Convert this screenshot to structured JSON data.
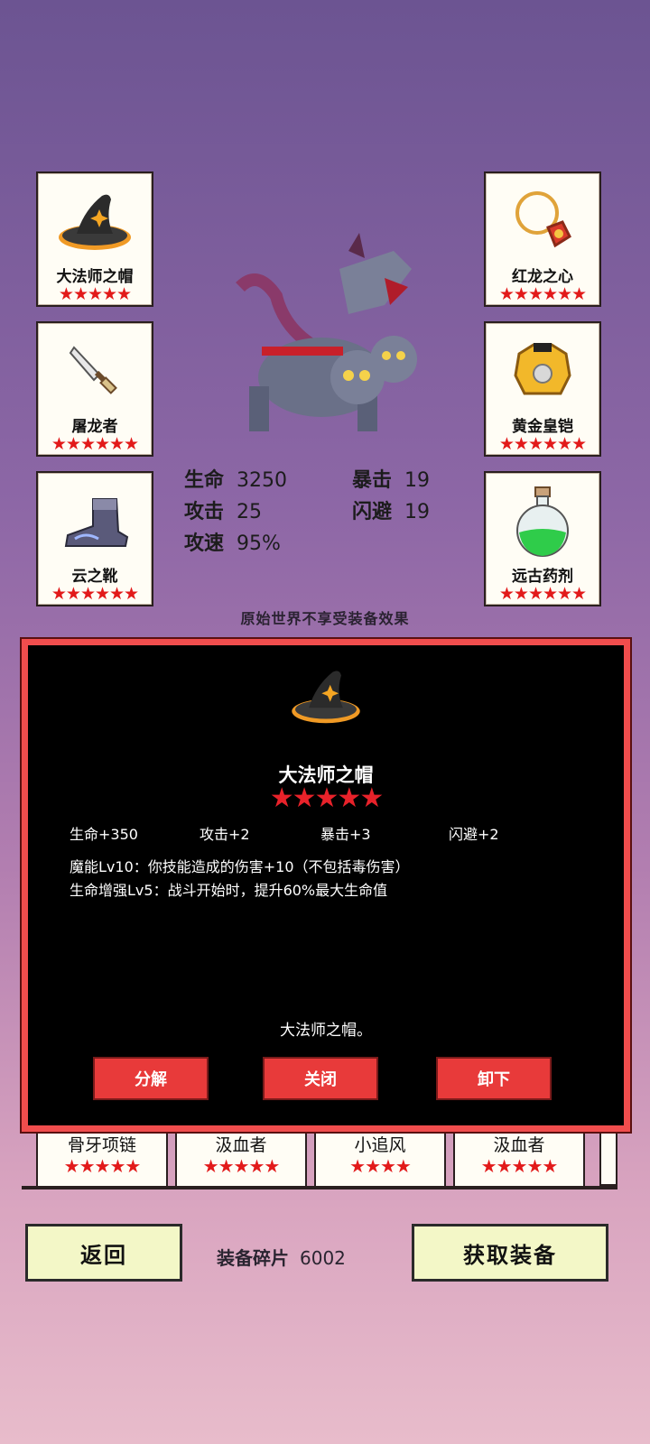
{
  "equipment_left": [
    {
      "name": "大法师之帽",
      "stars": "★★★★★",
      "icon": "wizard-hat-icon"
    },
    {
      "name": "屠龙者",
      "stars": "★★★★★★",
      "icon": "dagger-icon"
    },
    {
      "name": "云之靴",
      "stars": "★★★★★★",
      "icon": "boot-icon"
    }
  ],
  "equipment_right": [
    {
      "name": "红龙之心",
      "stars": "★★★★★★",
      "icon": "amulet-icon"
    },
    {
      "name": "黄金皇铠",
      "stars": "★★★★★★",
      "icon": "armor-icon"
    },
    {
      "name": "远古药剂",
      "stars": "★★★★★★",
      "icon": "potion-icon"
    }
  ],
  "stats": {
    "hp": {
      "label": "生命",
      "value": "3250"
    },
    "atk": {
      "label": "攻击",
      "value": "25"
    },
    "aspd": {
      "label": "攻速",
      "value": "95%"
    },
    "crit": {
      "label": "暴击",
      "value": "19"
    },
    "dodge": {
      "label": "闪避",
      "value": "19"
    }
  },
  "note": "原始世界不享受装备效果",
  "detail": {
    "title": "大法师之帽",
    "stars": "★★★★★",
    "bonuses": [
      "生命+350",
      "攻击+2",
      "暴击+3",
      "闪避+2"
    ],
    "skills": [
      "魔能Lv10：你技能造成的伤害+10（不包括毒伤害）",
      "生命增强Lv5：战斗开始时，提升60%最大生命值"
    ],
    "description": "大法师之帽。",
    "buttons": {
      "decompose": "分解",
      "close": "关闭",
      "unequip": "卸下"
    }
  },
  "list": [
    {
      "name": "骨牙项链",
      "stars": "★★★★★"
    },
    {
      "name": "汲血者",
      "stars": "★★★★★"
    },
    {
      "name": "小追风",
      "stars": "★★★★"
    },
    {
      "name": "汲血者",
      "stars": "★★★★★"
    }
  ],
  "footer": {
    "back": "返回",
    "shards_label": "装备碎片",
    "shards_value": "6002",
    "get": "获取装备"
  },
  "colors": {
    "accent_red": "#f04d4d",
    "star_red": "#e21a1a",
    "button_yellow": "#f3f7c7"
  }
}
